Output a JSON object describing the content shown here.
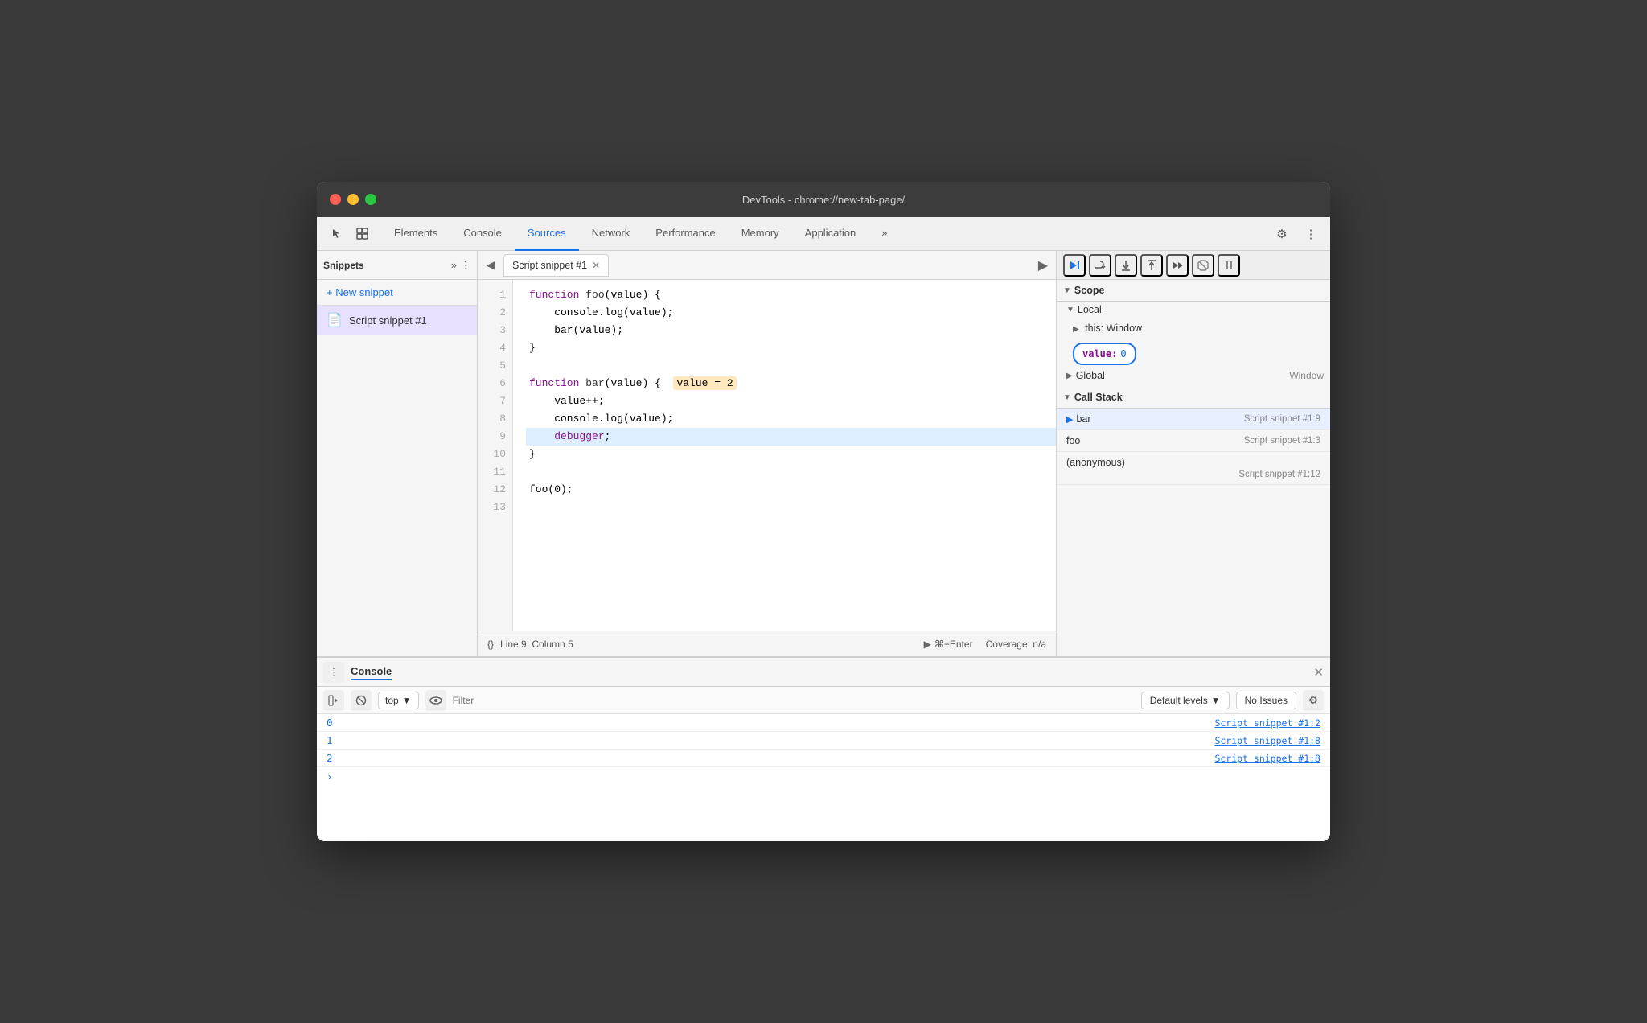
{
  "window": {
    "title": "DevTools - chrome://new-tab-page/"
  },
  "tabs": [
    {
      "label": "Elements",
      "active": false
    },
    {
      "label": "Console",
      "active": false
    },
    {
      "label": "Sources",
      "active": true
    },
    {
      "label": "Network",
      "active": false
    },
    {
      "label": "Performance",
      "active": false
    },
    {
      "label": "Memory",
      "active": false
    },
    {
      "label": "Application",
      "active": false
    }
  ],
  "left_panel": {
    "title": "Snippets",
    "new_snippet": "+ New snippet",
    "snippet_name": "Script snippet #1"
  },
  "editor": {
    "tab_name": "Script snippet #1",
    "status": {
      "line_col": "Line 9, Column 5",
      "shortcut": "⌘+Enter",
      "coverage": "Coverage: n/a"
    }
  },
  "scope": {
    "title": "Scope",
    "local_title": "Local",
    "this_entry": "this: Window",
    "value_key": "value:",
    "value_val": "0",
    "global_title": "Global",
    "global_val": "Window"
  },
  "call_stack": {
    "title": "Call Stack",
    "frames": [
      {
        "fn": "bar",
        "location": "Script snippet #1:9",
        "active": true
      },
      {
        "fn": "foo",
        "location": "Script snippet #1:3",
        "active": false
      },
      {
        "fn": "(anonymous)",
        "location": "Script snippet #1:12",
        "active": false
      }
    ]
  },
  "console": {
    "title": "Console",
    "toolbar": {
      "top_label": "top",
      "filter_placeholder": "Filter",
      "default_levels": "Default levels",
      "no_issues": "No Issues"
    },
    "rows": [
      {
        "value": "0",
        "source": "Script snippet #1:2"
      },
      {
        "value": "1",
        "source": "Script snippet #1:8"
      },
      {
        "value": "2",
        "source": "Script snippet #1:8"
      }
    ]
  }
}
